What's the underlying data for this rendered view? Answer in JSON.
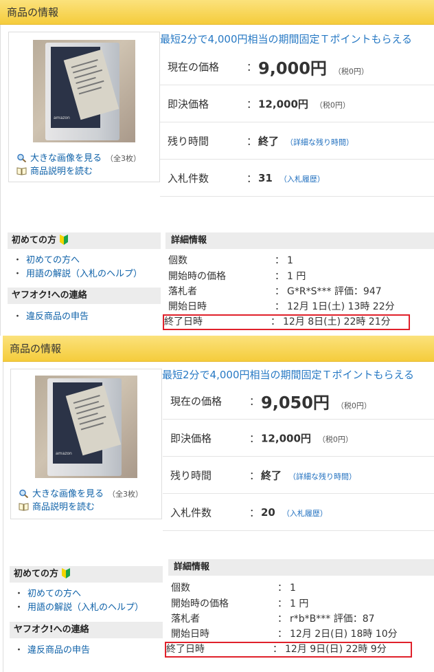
{
  "panels": [
    {
      "header": "商品の情報",
      "promo": "最短2分で4,000円相当の期間固定Ｔポイントもらえる",
      "image_links": {
        "enlarge": "大きな画像を見る",
        "enlarge_note": "（全3枚）",
        "description": "商品説明を読む"
      },
      "prices": [
        {
          "label": "現在の価格",
          "value": "9,000円",
          "note": "（税0円）"
        },
        {
          "label": "即決価格",
          "value": "12,000円",
          "note": "（税0円）"
        },
        {
          "label": "残り時間",
          "value": "終了",
          "link": "（詳細な残り時間）"
        },
        {
          "label": "入札件数",
          "value": "31",
          "link": "（入札履歴）"
        }
      ],
      "sidebar": {
        "beginner_title": "初めての方",
        "beginner_items": [
          "初めての方へ",
          "用語の解説（入札のヘルプ）"
        ],
        "contact_title": "ヤフオク!への連絡",
        "contact_items": [
          "違反商品の申告"
        ]
      },
      "details": {
        "title": "詳細情報",
        "rows": [
          {
            "key": "個数",
            "value": "1"
          },
          {
            "key": "開始時の価格",
            "value": "1 円"
          },
          {
            "key": "落札者",
            "value": "G*R*S*** 評価：947"
          },
          {
            "key": "開始日時",
            "value": "12月 1日(土) 13時 22分"
          },
          {
            "key": "終了日時",
            "value": "12月 8日(土) 22時 21分"
          }
        ]
      }
    },
    {
      "header": "商品の情報",
      "promo": "最短2分で4,000円相当の期間固定Ｔポイントもらえる",
      "image_links": {
        "enlarge": "大きな画像を見る",
        "enlarge_note": "（全3枚）",
        "description": "商品説明を読む"
      },
      "prices": [
        {
          "label": "現在の価格",
          "value": "9,050円",
          "note": "（税0円）"
        },
        {
          "label": "即決価格",
          "value": "12,000円",
          "note": "（税0円）"
        },
        {
          "label": "残り時間",
          "value": "終了",
          "link": "（詳細な残り時間）"
        },
        {
          "label": "入札件数",
          "value": "20",
          "link": "（入札履歴）"
        }
      ],
      "sidebar": {
        "beginner_title": "初めての方",
        "beginner_items": [
          "初めての方へ",
          "用語の解説（入札のヘルプ）"
        ],
        "contact_title": "ヤフオク!への連絡",
        "contact_items": [
          "違反商品の申告"
        ]
      },
      "details": {
        "title": "詳細情報",
        "rows": [
          {
            "key": "個数",
            "value": "1"
          },
          {
            "key": "開始時の価格",
            "value": "1 円"
          },
          {
            "key": "落札者",
            "value": "r*b*B*** 評価：87"
          },
          {
            "key": "開始日時",
            "value": "12月 2日(日) 18時 10分"
          },
          {
            "key": "終了日時",
            "value": "12月 9日(日) 22時 9分"
          }
        ]
      }
    }
  ],
  "colors": {
    "header_yellow": "#f5cc3c",
    "link_blue": "#0e61a8",
    "highlight_red": "#e0202a"
  }
}
